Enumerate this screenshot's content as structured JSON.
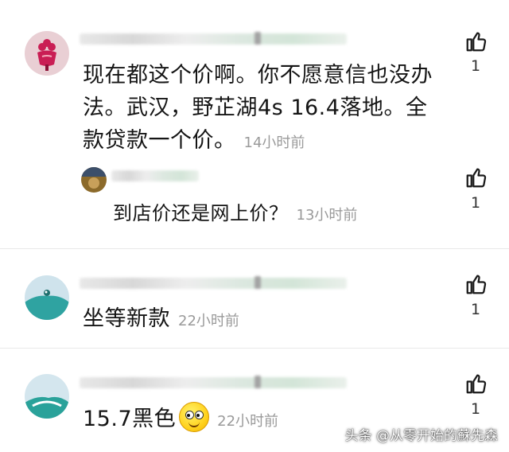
{
  "comments": [
    {
      "lines": [
        "现在都这个价啊。你不愿意信也没办",
        "法。武汉，野芷湖4s 16.4落地。全",
        "款贷款一个价。"
      ],
      "time": "14小时前",
      "likes": "1",
      "avatar_colors": [
        "#e9cfd4",
        "#c91e54"
      ],
      "reply": {
        "text": "到店价还是网上价？",
        "time": "13小时前",
        "likes": "1"
      }
    },
    {
      "text": "坐等新款",
      "time": "22小时前",
      "likes": "1",
      "avatar_colors": [
        "#cfe3ec",
        "#2fa3a1"
      ]
    },
    {
      "text": "15.7黑色",
      "time": "22小时前",
      "likes": "1",
      "emoji": "smiley-emoji",
      "avatar_colors": [
        "#d4e6ee",
        "#2aa29a"
      ]
    }
  ],
  "icons": {
    "like": "thumbs-up-icon"
  },
  "watermark": "头条 @从零开始的蘇先森"
}
